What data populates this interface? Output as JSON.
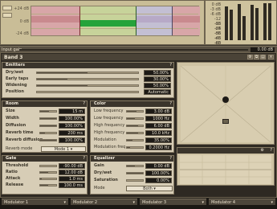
{
  "overview": {
    "db_labels": [
      "+24 dB",
      "0 dB",
      "-24 dB"
    ],
    "regions": [
      "#d8a6a8",
      "#c7d39a",
      "#c3bfd3",
      "#d8a6a8"
    ],
    "band_colors": [
      "#c98a8e",
      "#25a33a",
      "#b7a9c7",
      "#c98a8e"
    ]
  },
  "meter": {
    "labels": [
      "0 dB",
      "-3 dB",
      "-6 dB",
      "-12 dB",
      "-18 dB",
      "-24 dB",
      "-36 dB",
      "-48 dB",
      "-60 dB"
    ]
  },
  "gain": {
    "label": "Input gain",
    "value": "0.00 dB",
    "level": 0.5
  },
  "band": {
    "title": "Band 3",
    "icons": [
      "settings-icon",
      "copy-icon",
      "paste-icon",
      "close-icon"
    ]
  },
  "early": {
    "title": "Emitters",
    "rows": [
      {
        "label": "Dry/wet",
        "value": "50.00%",
        "level": 0.5
      },
      {
        "label": "Early taps",
        "value": "30.00%",
        "level": 0.3
      },
      {
        "label": "Widening",
        "value": "50.00%",
        "level": 0.5
      },
      {
        "label": "Position",
        "value": "Automatic",
        "level": 0.0
      }
    ]
  },
  "room": {
    "title": "Room",
    "rows": [
      {
        "label": "Size",
        "value": "15 m",
        "level": 0.55
      },
      {
        "label": "Width",
        "value": "100.00%",
        "level": 1.0
      },
      {
        "label": "Diffusion",
        "value": "100.00%",
        "level": 1.0
      },
      {
        "label": "Reverb time",
        "value": "200 ms",
        "level": 0.3
      },
      {
        "label": "Reverb diffusion",
        "value": "100.00%",
        "level": 1.0
      }
    ],
    "select_label": "Reverb mode",
    "select_value": "Mode 1"
  },
  "color": {
    "title": "Color",
    "rows": [
      {
        "label": "Low frequency",
        "value": "3.00 dB",
        "level": 0.6
      },
      {
        "label": "Low frequency",
        "value": "1000 Hz",
        "level": 0.5
      },
      {
        "label": "High frequency",
        "value": "6.00 dB",
        "level": 0.7
      },
      {
        "label": "High frequency",
        "value": "10.0 kHz",
        "level": 0.7
      },
      {
        "label": "Modulation",
        "value": "35.00%",
        "level": 0.35
      },
      {
        "label": "Modulation freq",
        "value": "0.2000 Hz",
        "level": 0.2
      }
    ]
  },
  "gate": {
    "title": "Gate",
    "rows": [
      {
        "label": "Threshold",
        "value": "-90.00 dB",
        "level": 0.0
      },
      {
        "label": "Ratio",
        "value": "12.00 dB",
        "level": 0.5
      },
      {
        "label": "Attack",
        "value": "1.0 ms",
        "level": 0.1
      },
      {
        "label": "Release",
        "value": "100.0 ms",
        "level": 0.5
      }
    ]
  },
  "eq": {
    "title": "Equalizer",
    "rows": [
      {
        "label": "Gain",
        "value": "0.00 dB",
        "level": 0.5
      },
      {
        "label": "Dry/wet",
        "value": "100.00%",
        "level": 1.0
      },
      {
        "label": "Saturation",
        "value": "0.00%",
        "level": 0.0
      }
    ],
    "select_label": "Mode",
    "select_value": "Both"
  },
  "tabs": [
    "Modulator 1",
    "Modulator 2",
    "Modulator 3",
    "Modulator 4"
  ]
}
